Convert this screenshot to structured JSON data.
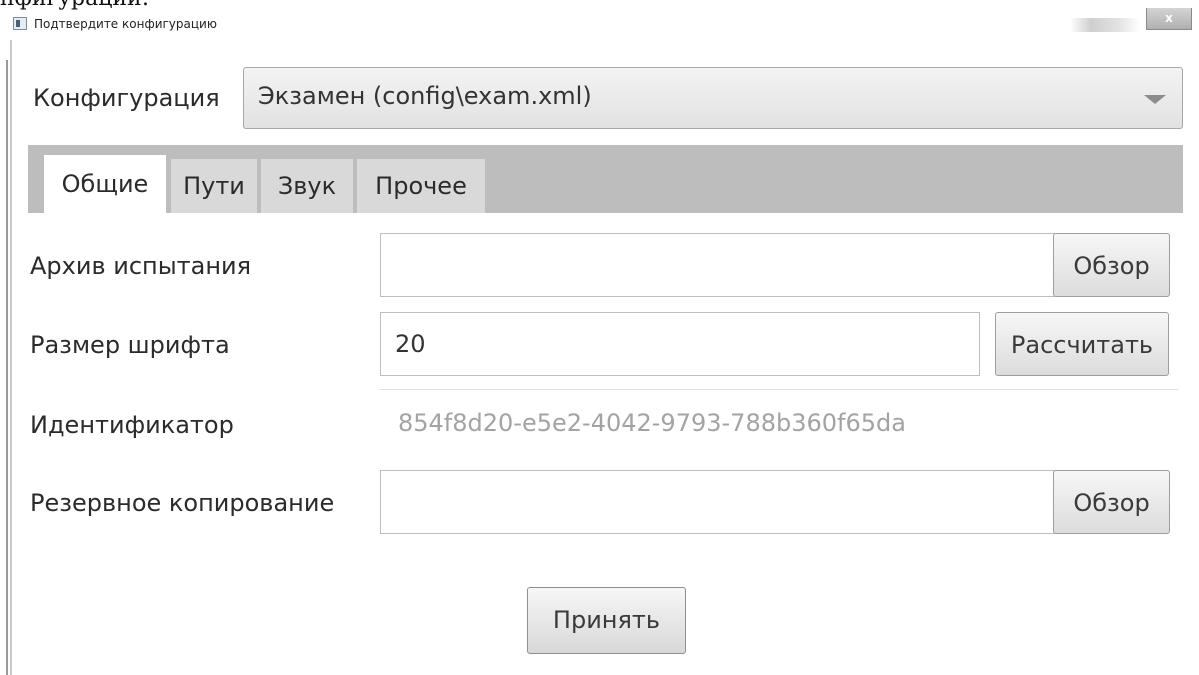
{
  "caption_fragment": "нфигурации:",
  "window": {
    "title": "Подтвердите конфигурацию",
    "close_label": "x"
  },
  "config": {
    "label": "Конфигурация",
    "selected_value": "Экзамен (config\\exam.xml)"
  },
  "tabs": [
    {
      "label": "Общие",
      "active": true
    },
    {
      "label": "Пути",
      "active": false
    },
    {
      "label": "Звук",
      "active": false
    },
    {
      "label": "Прочее",
      "active": false
    }
  ],
  "form": {
    "archive": {
      "label": "Архив испытания",
      "value": "",
      "button": "Обзор"
    },
    "font_size": {
      "label": "Размер шрифта",
      "value": "20",
      "button": "Рассчитать"
    },
    "identifier": {
      "label": "Идентификатор",
      "value": "854f8d20-e5e2-4042-9793-788b360f65da"
    },
    "backup": {
      "label": "Резервное копирование",
      "value": "",
      "button": "Обзор"
    }
  },
  "accept_button": "Принять"
}
